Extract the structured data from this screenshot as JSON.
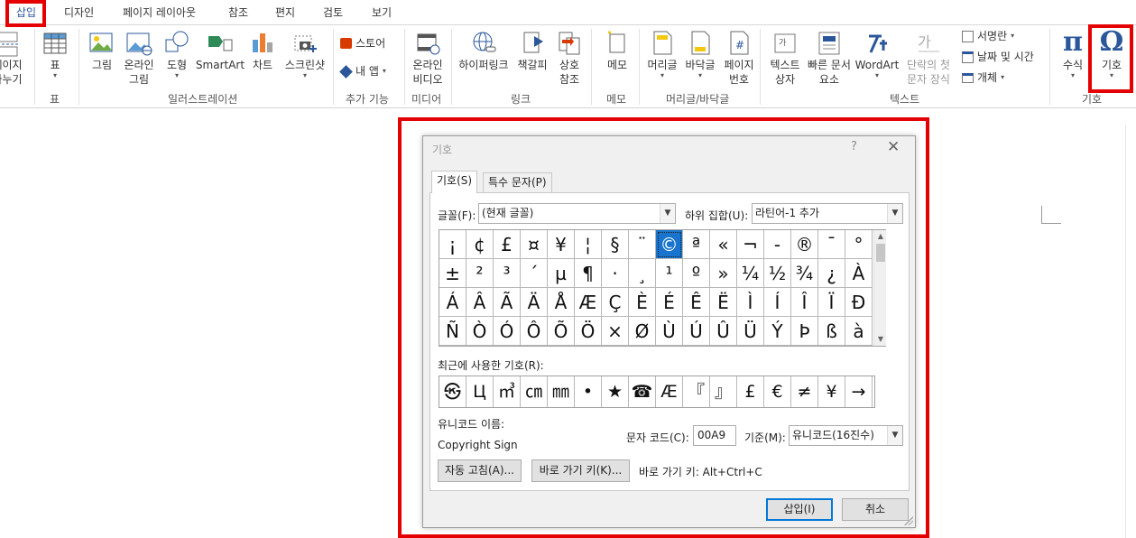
{
  "tabs": [
    "삽입",
    "디자인",
    "페이지 레이아웃",
    "참조",
    "편지",
    "검토",
    "보기"
  ],
  "ribbon": {
    "buttons": {
      "page_break_1": "페이지",
      "page_break_2": "나누기",
      "table": "표",
      "picture": "그림",
      "online_picture_1": "온라인",
      "online_picture_2": "그림",
      "shapes": "도형",
      "smartart": "SmartArt",
      "chart": "차트",
      "screenshot": "스크린샷",
      "store": "스토어",
      "my_apps": "내 앱",
      "online_video_1": "온라인",
      "online_video_2": "비디오",
      "hyperlink": "하이퍼링크",
      "bookmark": "책갈피",
      "cross_ref_1": "상호",
      "cross_ref_2": "참조",
      "comment": "메모",
      "header": "머리글",
      "footer": "바닥글",
      "page_number_1": "페이지",
      "page_number_2": "번호",
      "text_box_1": "텍스트",
      "text_box_2": "상자",
      "quick_parts_1": "빠른 문서",
      "quick_parts_2": "요소",
      "wordart": "WordArt",
      "drop_cap_1": "단락의 첫",
      "drop_cap_2": "문자 장식",
      "signature_line": "서명란",
      "date_time": "날짜 및 시간",
      "object": "개체",
      "equation": "수식",
      "symbol": "기호"
    },
    "groups": {
      "table": "표",
      "illustrations": "일러스트레이션",
      "addins": "추가 기능",
      "media": "미디어",
      "links": "링크",
      "comments": "메모",
      "header_footer": "머리글/바닥글",
      "text": "텍스트",
      "symbols": "기호"
    }
  },
  "dialog": {
    "title": "기호",
    "help": "?",
    "close": "✕",
    "tabs": [
      "기호(S)",
      "특수 문자(P)"
    ],
    "font_label": "글꼴(F):",
    "font_value": "(현재 글꼴)",
    "subset_label": "하위 집합(U):",
    "subset_value": "라틴어-1 추가",
    "symbols": [
      [
        "¡",
        "¢",
        "£",
        "¤",
        "¥",
        "¦",
        "§",
        "¨",
        "©",
        "ª",
        "«",
        "¬",
        "-",
        "®",
        "¯",
        "°"
      ],
      [
        "±",
        "²",
        "³",
        "´",
        "µ",
        "¶",
        "·",
        "¸",
        "¹",
        "º",
        "»",
        "¼",
        "½",
        "¾",
        "¿",
        "À"
      ],
      [
        "Á",
        "Â",
        "Ã",
        "Ä",
        "Å",
        "Æ",
        "Ç",
        "È",
        "É",
        "Ê",
        "Ë",
        "Ì",
        "Í",
        "Î",
        "Ï",
        "Ð"
      ],
      [
        "Ñ",
        "Ò",
        "Ó",
        "Ô",
        "Õ",
        "Ö",
        "×",
        "Ø",
        "Ù",
        "Ú",
        "Û",
        "Ü",
        "Ý",
        "Þ",
        "ß",
        "à"
      ]
    ],
    "selected_symbol": "©",
    "recent_label": "최근에 사용한 기호(R):",
    "recent": [
      "㉿",
      "Ц",
      "㎥",
      "㎝",
      "㎜",
      "•",
      "★",
      "☎",
      "Æ",
      "『",
      "』",
      "£",
      "€",
      "≠",
      "¥",
      "→"
    ],
    "unicode_name_label": "유니코드 이름:",
    "unicode_name": "Copyright Sign",
    "char_code_label": "문자 코드(C):",
    "char_code": "00A9",
    "from_label": "기준(M):",
    "from_value": "유니코드(16진수)",
    "autocorrect_button": "자동 고침(A)...",
    "shortcut_button": "바로 가기 키(K)...",
    "shortcut_text": "바로 가기 키: Alt+Ctrl+C",
    "insert_button": "삽입(I)",
    "cancel_button": "취소"
  },
  "colors": {
    "highlight": "#e40000",
    "accent": "#2b579a",
    "selection": "#1874cd"
  }
}
